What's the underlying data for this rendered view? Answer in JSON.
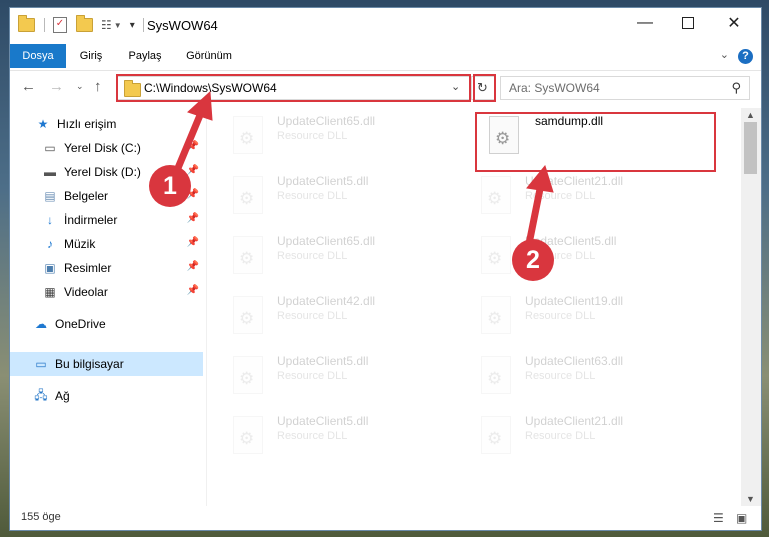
{
  "window": {
    "title": "SysWOW64"
  },
  "ribbon": {
    "tabs": [
      "Dosya",
      "Giriş",
      "Paylaş",
      "Görünüm"
    ],
    "help": "?"
  },
  "nav": {
    "address": "C:\\Windows\\SysWOW64",
    "search_placeholder": "Ara: SysWOW64"
  },
  "sidebar": {
    "quick_access": "Hızlı erişim",
    "items": [
      "Yerel Disk (C:)",
      "Yerel Disk (D:)",
      "Belgeler",
      "İndirmeler",
      "Müzik",
      "Resimler",
      "Videolar"
    ],
    "onedrive": "OneDrive",
    "this_pc": "Bu bilgisayar",
    "network": "Ağ"
  },
  "files": {
    "highlighted": {
      "name": "samdump.dll",
      "type": ""
    },
    "left": [
      {
        "name": "UpdateClient65.dll",
        "type": "Resource DLL"
      },
      {
        "name": "UpdateClient5.dll",
        "type": "Resource DLL"
      },
      {
        "name": "UpdateClient65.dll",
        "type": "Resource DLL"
      },
      {
        "name": "UpdateClient42.dll",
        "type": "Resource DLL"
      },
      {
        "name": "UpdateClient5.dll",
        "type": "Resource DLL"
      },
      {
        "name": "UpdateClient5.dll",
        "type": "Resource DLL"
      }
    ],
    "right": [
      {
        "name": "UpdateClient21.dll",
        "type": "Resource DLL"
      },
      {
        "name": "UpdateClient5.dll",
        "type": "Resource DLL"
      },
      {
        "name": "UpdateClient19.dll",
        "type": "Resource DLL"
      },
      {
        "name": "UpdateClient63.dll",
        "type": "Resource DLL"
      },
      {
        "name": "UpdateClient21.dll",
        "type": "Resource DLL"
      }
    ]
  },
  "status": {
    "count": "155 öge"
  },
  "annotations": {
    "step1": "1",
    "step2": "2"
  },
  "colors": {
    "accent": "#1979ca",
    "highlight": "#d9363e",
    "selected": "#cce8ff"
  }
}
